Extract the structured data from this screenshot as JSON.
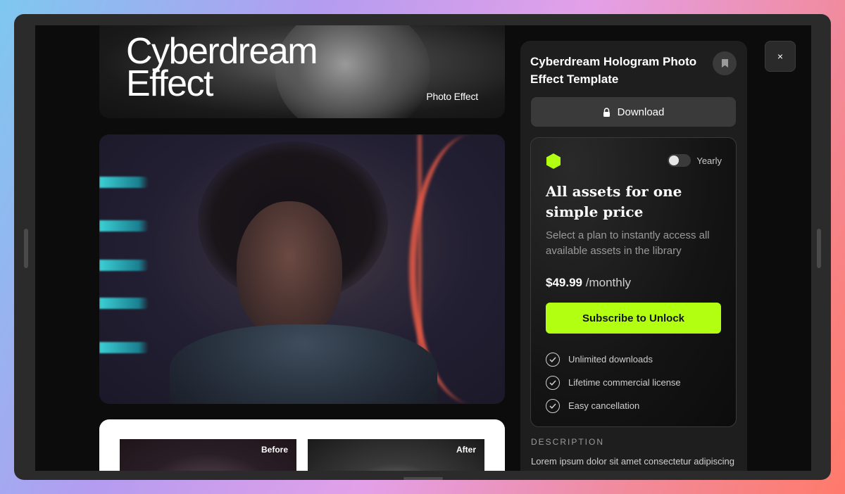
{
  "preview": {
    "hero_title_line1": "Cyberdream",
    "hero_title_line2": "Effect",
    "hero_subtitle": "Photo Effect",
    "before_label": "Before",
    "after_label": "After"
  },
  "panel": {
    "title": "Cyberdream Hologram Photo Effect Template",
    "download_label": "Download",
    "plan": {
      "toggle_label": "Yearly",
      "heading": "All assets for one simple price",
      "description": "Select a plan to instantly access all available assets in the library",
      "price": "$49.99",
      "period": "/monthly",
      "subscribe_label": "Subscribe to Unlock",
      "features": [
        "Unlimited downloads",
        "Lifetime commercial license",
        "Easy cancellation"
      ]
    },
    "description_title": "DESCRIPTION",
    "description_text": "Lorem ipsum dolor sit amet consectetur adipiscing elit. Sed do eiusmod tempor incididunt ut labore"
  },
  "close_label": "×",
  "colors": {
    "accent": "#b3ff12",
    "panel_bg": "#1e1e1e"
  }
}
